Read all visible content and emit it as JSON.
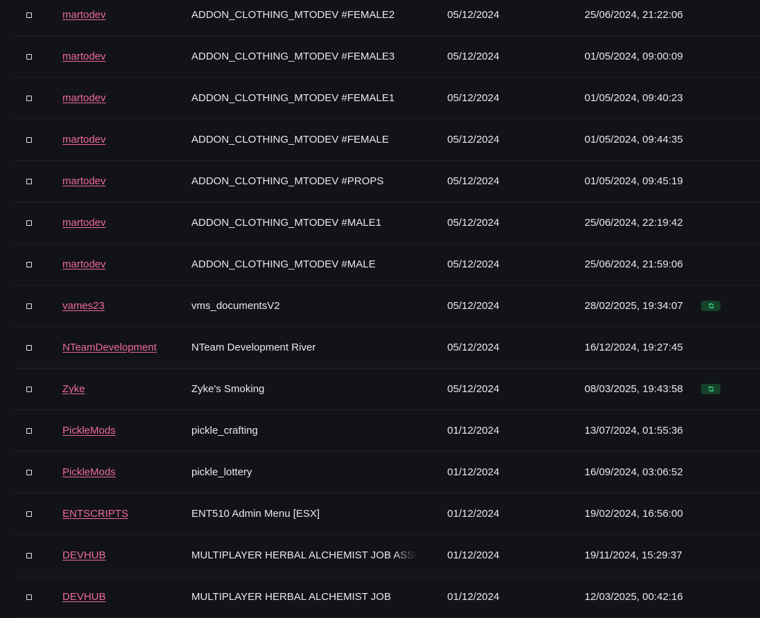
{
  "colors": {
    "background": "#111319",
    "author_link": "#f06a9a",
    "update_badge_bg": "#16412a",
    "update_badge_icon": "#3ddc84"
  },
  "rows": [
    {
      "author": "martodev",
      "name": "ADDON_CLOTHING_MTODEV #FEMALE2",
      "date": "05/12/2024",
      "updated": "25/06/2024, 21:22:06",
      "update_badge": false
    },
    {
      "author": "martodev",
      "name": "ADDON_CLOTHING_MTODEV #FEMALE3",
      "date": "05/12/2024",
      "updated": "01/05/2024, 09:00:09",
      "update_badge": false
    },
    {
      "author": "martodev",
      "name": "ADDON_CLOTHING_MTODEV #FEMALE1",
      "date": "05/12/2024",
      "updated": "01/05/2024, 09:40:23",
      "update_badge": false
    },
    {
      "author": "martodev",
      "name": "ADDON_CLOTHING_MTODEV #FEMALE",
      "date": "05/12/2024",
      "updated": "01/05/2024, 09:44:35",
      "update_badge": false
    },
    {
      "author": "martodev",
      "name": "ADDON_CLOTHING_MTODEV #PROPS",
      "date": "05/12/2024",
      "updated": "01/05/2024, 09:45:19",
      "update_badge": false
    },
    {
      "author": "martodev",
      "name": "ADDON_CLOTHING_MTODEV #MALE1",
      "date": "05/12/2024",
      "updated": "25/06/2024, 22:19:42",
      "update_badge": false
    },
    {
      "author": "martodev",
      "name": "ADDON_CLOTHING_MTODEV #MALE",
      "date": "05/12/2024",
      "updated": "25/06/2024, 21:59:06",
      "update_badge": false
    },
    {
      "author": "vames23",
      "name": "vms_documentsV2",
      "date": "05/12/2024",
      "updated": "28/02/2025, 19:34:07",
      "update_badge": true
    },
    {
      "author": "NTeamDevelopment",
      "name": "NTeam Development River",
      "date": "05/12/2024",
      "updated": "16/12/2024, 19:27:45",
      "update_badge": false
    },
    {
      "author": "Zyke",
      "name": "Zyke's Smoking",
      "date": "05/12/2024",
      "updated": "08/03/2025, 19:43:58",
      "update_badge": true
    },
    {
      "author": "PickleMods",
      "name": "pickle_crafting",
      "date": "01/12/2024",
      "updated": "13/07/2024, 01:55:36",
      "update_badge": false
    },
    {
      "author": "PickleMods",
      "name": "pickle_lottery",
      "date": "01/12/2024",
      "updated": "16/09/2024, 03:06:52",
      "update_badge": false
    },
    {
      "author": "ENTSCRIPTS",
      "name": "ENT510 Admin Menu [ESX]",
      "date": "01/12/2024",
      "updated": "19/02/2024, 16:56:00",
      "update_badge": false
    },
    {
      "author": "DEVHUB",
      "name": "MULTIPLAYER HERBAL ALCHEMIST JOB ASSETS",
      "date": "01/12/2024",
      "updated": "19/11/2024, 15:29:37",
      "update_badge": false
    },
    {
      "author": "DEVHUB",
      "name": "MULTIPLAYER HERBAL ALCHEMIST JOB",
      "date": "01/12/2024",
      "updated": "12/03/2025, 00:42:16",
      "update_badge": false
    }
  ]
}
